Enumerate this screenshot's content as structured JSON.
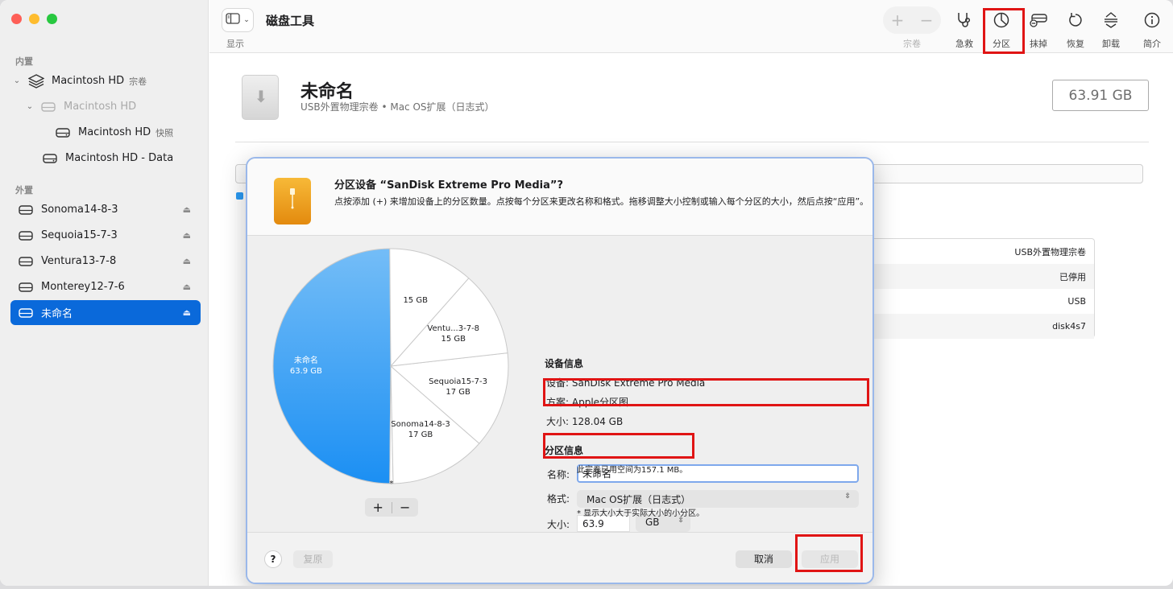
{
  "sidebar": {
    "internal_label": "内置",
    "external_label": "外置",
    "internal": [
      {
        "label": "Macintosh HD",
        "sub": "宗卷"
      },
      {
        "label": "Macintosh HD"
      },
      {
        "label": "Macintosh HD",
        "sub": "快照"
      },
      {
        "label": "Macintosh HD - Data"
      }
    ],
    "external": [
      {
        "label": "Sonoma14-8-3"
      },
      {
        "label": "Sequoia15-7-3"
      },
      {
        "label": "Ventura13-7-8"
      },
      {
        "label": "Monterey12-7-6"
      },
      {
        "label": "未命名"
      }
    ]
  },
  "toolbar": {
    "view_label": "显示",
    "title": "磁盘工具",
    "volume_label": "宗卷",
    "buttons": [
      {
        "label": "急救",
        "icon": "stethoscope-icon"
      },
      {
        "label": "分区",
        "icon": "partition-pie-icon"
      },
      {
        "label": "抹掉",
        "icon": "erase-disk-icon"
      },
      {
        "label": "恢复",
        "icon": "restore-icon"
      },
      {
        "label": "卸载",
        "icon": "unmount-icon"
      },
      {
        "label": "简介",
        "icon": "info-icon"
      }
    ]
  },
  "main": {
    "volume_name": "未命名",
    "volume_desc": "USB外置物理宗卷 • Mac OS扩展（日志式）",
    "capacity": "63.91 GB",
    "info_rows": [
      "USB外置物理宗卷",
      "已停用",
      "USB",
      "disk4s7"
    ]
  },
  "sheet": {
    "title": "分区设备 “SanDisk Extreme Pro Media”?",
    "subtitle": "点按添加 (+) 来增加设备上的分区数量。点按每个分区来更改名称和格式。拖移调整大小控制或输入每个分区的大小，然后点按“应用”。",
    "device_info_title": "设备信息",
    "device_rows": [
      {
        "key": "设备:",
        "value": "SanDisk Extreme Pro Media"
      },
      {
        "key": "方案:",
        "value": "Apple分区图"
      },
      {
        "key": "大小:",
        "value": "128.04 GB"
      }
    ],
    "partition_info_title": "分区信息",
    "name_label": "名称:",
    "name_value": "未命名",
    "format_label": "格式:",
    "format_value": "Mac OS扩展（日志式）",
    "size_label": "大小:",
    "size_value": "63.9",
    "unit_value": "GB",
    "used_note": "此宗卷已用空间为157.1 MB。",
    "footnote": "* 显示大小大于实际大小的小分区。",
    "plus": "+",
    "minus": "−",
    "help": "?",
    "revert": "复原",
    "cancel": "取消",
    "apply": "应用",
    "asterisk": "*"
  },
  "chart_data": {
    "type": "pie",
    "slices": [
      {
        "name": "未命名",
        "value": 63.9,
        "label": "63.9 GB",
        "selected": true,
        "color": "#1b8ff3"
      },
      {
        "name": "",
        "value": 0.6,
        "label": "*",
        "color": "#ffffff"
      },
      {
        "name": "Sonoma14-8-3",
        "value": 17,
        "label": "17 GB",
        "color": "#ffffff"
      },
      {
        "name": "Sequoia15-7-3",
        "value": 17,
        "label": "17 GB",
        "color": "#ffffff"
      },
      {
        "name": "Ventu...3-7-8",
        "value": 15,
        "label": "15 GB",
        "color": "#ffffff"
      },
      {
        "name": "",
        "value": 15,
        "label": "15 GB",
        "color": "#ffffff"
      }
    ]
  },
  "colors": {
    "accent": "#0a69da",
    "highlight_box": "#e01414",
    "usb_orange": "#f0a020"
  }
}
